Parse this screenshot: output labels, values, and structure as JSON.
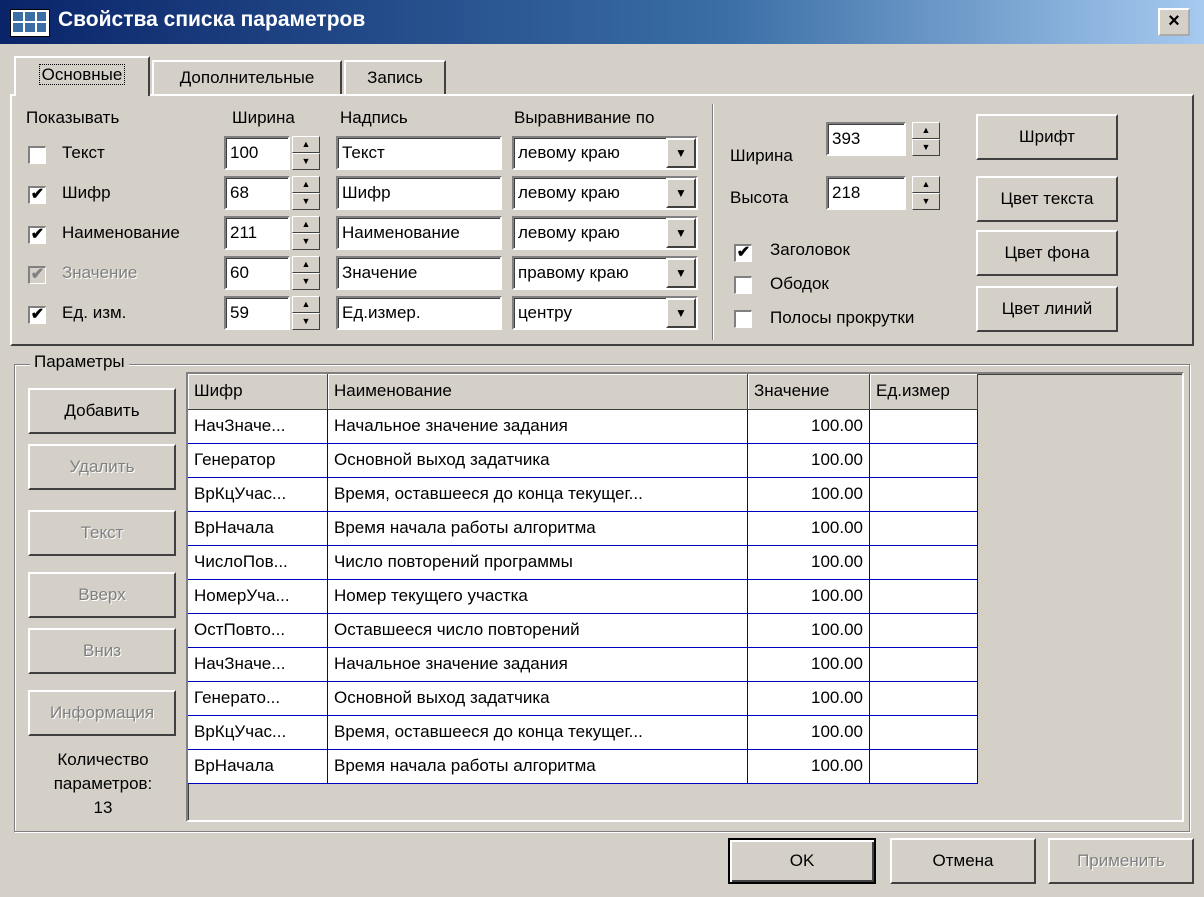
{
  "window": {
    "title": "Свойства списка параметров",
    "close_label": "×"
  },
  "tabs": [
    {
      "label": "Основные",
      "active": true
    },
    {
      "label": "Дополнительные",
      "active": false
    },
    {
      "label": "Запись",
      "active": false
    }
  ],
  "columns_config": {
    "headers": {
      "show": "Показывать",
      "width": "Ширина",
      "caption": "Надпись",
      "align": "Выравнивание по"
    },
    "rows": [
      {
        "label": "Текст",
        "checked": false,
        "enabled": true,
        "width": "100",
        "caption": "Текст",
        "align": "левому краю"
      },
      {
        "label": "Шифр",
        "checked": true,
        "enabled": true,
        "width": "68",
        "caption": "Шифр",
        "align": "левому краю"
      },
      {
        "label": "Наименование",
        "checked": true,
        "enabled": true,
        "width": "211",
        "caption": "Наименование",
        "align": "левому краю"
      },
      {
        "label": "Значение",
        "checked": true,
        "enabled": false,
        "width": "60",
        "caption": "Значение",
        "align": "правому краю"
      },
      {
        "label": "Ед. изм.",
        "checked": true,
        "enabled": true,
        "width": "59",
        "caption": "Ед.измер.",
        "align": "центру"
      }
    ]
  },
  "list_props": {
    "width_label": "Ширина",
    "width_value": "393",
    "height_label": "Высота",
    "height_value": "218",
    "options": [
      {
        "label": "Заголовок",
        "checked": true
      },
      {
        "label": "Ободок",
        "checked": false
      },
      {
        "label": "Полосы прокрутки",
        "checked": false
      }
    ],
    "buttons": {
      "font": "Шрифт",
      "text_color": "Цвет текста",
      "bg_color": "Цвет фона",
      "line_color": "Цвет линий"
    }
  },
  "params": {
    "group_label": "Параметры",
    "buttons": {
      "add": "Добавить",
      "delete": "Удалить",
      "text": "Текст",
      "up": "Вверх",
      "down": "Вниз",
      "info": "Информация"
    },
    "count_label_1": "Количество",
    "count_label_2": "параметров:",
    "count_value": "13",
    "table": {
      "headers": [
        "Шифр",
        "Наименование",
        "Значение",
        "Ед.измер"
      ],
      "rows": [
        [
          "НачЗначе...",
          "Начальное значение задания",
          "100.00",
          ""
        ],
        [
          "Генератор",
          "Основной выход задатчика",
          "100.00",
          ""
        ],
        [
          "ВрКцУчас...",
          "Время, оставшееся до конца текущег...",
          "100.00",
          ""
        ],
        [
          "ВрНачала",
          "Время начала работы алгоритма",
          "100.00",
          ""
        ],
        [
          "ЧислоПов...",
          "Число повторений программы",
          "100.00",
          ""
        ],
        [
          "НомерУча...",
          "Номер текущего участка",
          "100.00",
          ""
        ],
        [
          "ОстПовто...",
          "Оставшееся число повторений",
          "100.00",
          ""
        ],
        [
          "НачЗначе...",
          "Начальное значение задания",
          "100.00",
          ""
        ],
        [
          "Генерато...",
          "Основной выход задатчика",
          "100.00",
          ""
        ],
        [
          "ВрКцУчас...",
          "Время, оставшееся до конца текущег...",
          "100.00",
          ""
        ],
        [
          "ВрНачала",
          "Время начала работы алгоритма",
          "100.00",
          ""
        ]
      ]
    }
  },
  "footer": {
    "ok": "OK",
    "cancel": "Отмена",
    "apply": "Применить"
  },
  "icons": {
    "dropdown": "▼",
    "spin_up": "▲",
    "spin_down": "▼",
    "check": "✔"
  }
}
